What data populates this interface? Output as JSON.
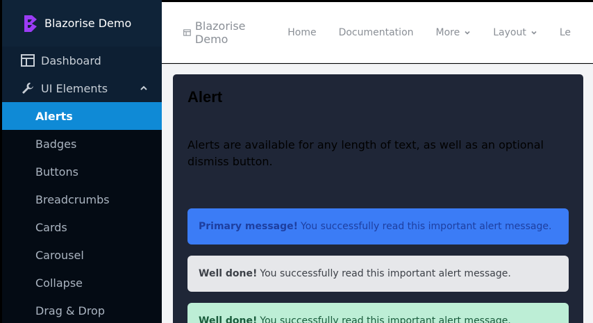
{
  "sidebar": {
    "brand": "Blazorise Demo",
    "top_items": [
      {
        "label": "Dashboard",
        "icon": "layout-icon"
      },
      {
        "label": "UI Elements",
        "icon": "wrench-icon"
      }
    ],
    "sub_items": [
      {
        "label": "Alerts",
        "active": true
      },
      {
        "label": "Badges"
      },
      {
        "label": "Buttons"
      },
      {
        "label": "Breadcrumbs"
      },
      {
        "label": "Cards"
      },
      {
        "label": "Carousel"
      },
      {
        "label": "Collapse"
      },
      {
        "label": "Drag & Drop"
      }
    ]
  },
  "topbar": {
    "brand": "Blazorise Demo",
    "links": [
      "Home",
      "Documentation",
      "More",
      "Layout",
      "Le"
    ]
  },
  "main": {
    "title": "Alert",
    "description": "Alerts are available for any length of text, as well as an optional dismiss button.",
    "alerts": [
      {
        "strong": "Primary message!",
        "text": "You successfully read this important alert message."
      },
      {
        "strong": "Well done!",
        "text": "You successfully read this important alert message."
      },
      {
        "strong": "Well done!",
        "text": "You successfully read this important alert message."
      }
    ]
  },
  "colors": {
    "sidebar_bg": "#0b1728",
    "active": "#0f8ad6",
    "card_bg": "#1f2637",
    "alert_primary": "#3b7cf6",
    "alert_secondary": "#e6e7ea",
    "alert_success": "#bdeed6",
    "logo": "#9b3cf5"
  }
}
